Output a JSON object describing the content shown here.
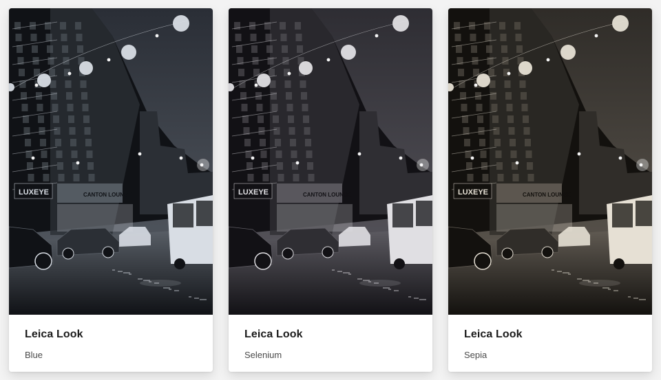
{
  "cards": [
    {
      "title": "Leica Look",
      "subtitle": "Blue",
      "tone": {
        "sky": "#2a2e36",
        "mid": "#5a6068",
        "light": "#d8dde4",
        "dark": "#101216",
        "street": "#2b2f35"
      }
    },
    {
      "title": "Leica Look",
      "subtitle": "Selenium",
      "tone": {
        "sky": "#2e2d33",
        "mid": "#5e5c63",
        "light": "#e0dfe3",
        "dark": "#121115",
        "street": "#2f2e33"
      }
    },
    {
      "title": "Leica Look",
      "subtitle": "Sepia",
      "tone": {
        "sky": "#2f2c28",
        "mid": "#625c54",
        "light": "#e6e0d4",
        "dark": "#13110e",
        "street": "#302d29"
      }
    }
  ],
  "sign_text": {
    "luxeye": "LUXEYE",
    "canton": "CANTON LOUNGE"
  }
}
